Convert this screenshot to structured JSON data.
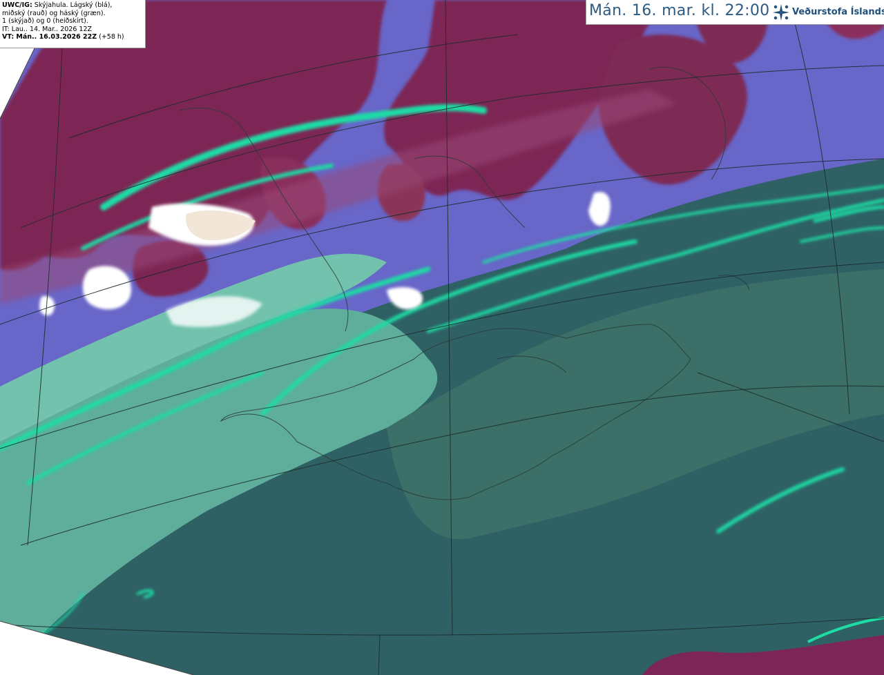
{
  "header": {
    "valid_time": "Mán. 16. mar. kl. 22:00",
    "brand_name": "Veðurstofa Íslands",
    "brand_color": "#1f4f7a",
    "time_color": "#2d5a82"
  },
  "legend": {
    "product": "UWC/IG:",
    "line1_rest": " Skýjahula. Lágský (blá),",
    "line2": "miðský (rauð) og háský (græn).",
    "line3": "1 (skýjað) og 0 (heiðskírt).",
    "issue_time": "IT: Lau.. 14. Mar.. 2026 12Z",
    "valid_label": "VT: Mán.. 16.03.2026 22Z",
    "lead_time": " (+58 h)"
  },
  "map": {
    "layers": [
      "low-cloud",
      "mid-cloud",
      "high-cloud",
      "coastlines",
      "projection-grid"
    ],
    "colors": {
      "low_cloud": "#6a69cc",
      "mid_cloud": "#7a2450",
      "high_cloud": "#1ed9a0",
      "overlap_dark": "#2e5e66",
      "clear_white": "#ffffff"
    }
  }
}
